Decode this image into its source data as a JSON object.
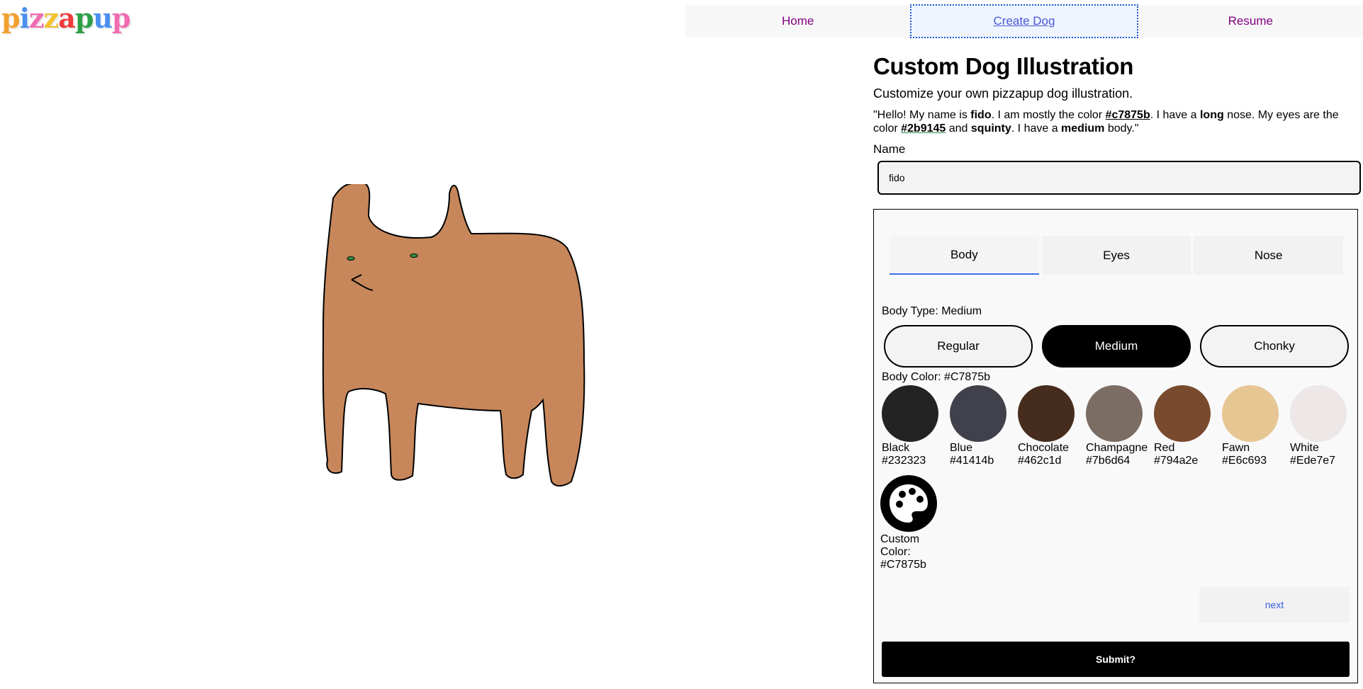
{
  "logo": {
    "letters": [
      "p",
      "i",
      "z",
      "z",
      "a",
      "p",
      "u",
      "p"
    ],
    "colors": [
      "#f2a12e",
      "#4a8ff0",
      "#f06bb0",
      "#f2c12e",
      "#ee3b3b",
      "#2f9e48",
      "#4a8ff0",
      "#f06bb0"
    ]
  },
  "nav": {
    "home": "Home",
    "create_dog": "Create Dog",
    "resume": "Resume"
  },
  "page": {
    "title": "Custom Dog Illustration",
    "intro": "Customize your own pizzapup dog illustration.",
    "bio": {
      "p1": "\"Hello! My name is ",
      "name": "fido",
      "p2": ". I am mostly the color ",
      "body_color": "#c7875b",
      "p3": ". I have a ",
      "nose": "long",
      "p4": " nose. My eyes are the color ",
      "eye_color": "#2b9145",
      "p5": " and ",
      "eye_shape": "squinty",
      "p6": ". I have a ",
      "body_type": "medium",
      "p7": " body.\""
    },
    "name_label": "Name",
    "name_value": "fido"
  },
  "editor": {
    "tabs": [
      "Body",
      "Eyes",
      "Nose"
    ],
    "active_tab": "Body",
    "body_type_label": "Body Type: Medium",
    "body_types": [
      "Regular",
      "Medium",
      "Chonky"
    ],
    "selected_body_type": "Medium",
    "body_color_label": "Body Color: #C7875b",
    "swatches": [
      {
        "name": "Black",
        "hex": "#232323"
      },
      {
        "name": "Blue",
        "hex": "#41414b"
      },
      {
        "name": "Chocolate",
        "hex": "#462c1d"
      },
      {
        "name": "Champagne",
        "hex": "#7b6d64"
      },
      {
        "name": "Red",
        "hex": "#794a2e"
      },
      {
        "name": "Fawn",
        "hex": "#E6c693"
      },
      {
        "name": "White",
        "hex": "#Ede7e7"
      }
    ],
    "custom_label": "Custom Color: #C7875b",
    "next_label": "next",
    "submit_label": "Submit?"
  },
  "dog": {
    "fill": "#c7875b",
    "eye_color": "#2b9145"
  }
}
